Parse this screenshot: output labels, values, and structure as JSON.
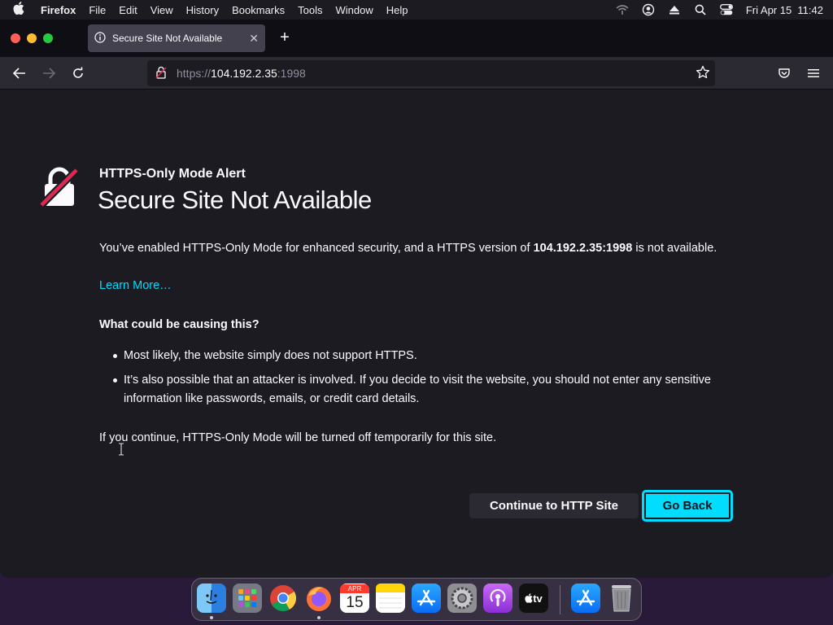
{
  "menubar": {
    "apple": "",
    "app_name": "Firefox",
    "items": [
      "File",
      "Edit",
      "View",
      "History",
      "Bookmarks",
      "Tools",
      "Window",
      "Help"
    ],
    "clock": "Fri Apr 15  11:42"
  },
  "tab": {
    "title": "Secure Site Not Available",
    "close": "✕"
  },
  "newtab": "+",
  "urlbar": {
    "scheme": "https://",
    "host": "104.192.2.35",
    "port": ":1998"
  },
  "page": {
    "kicker": "HTTPS-Only Mode Alert",
    "title": "Secure Site Not Available",
    "desc_before": "You’ve enabled HTTPS-Only Mode for enhanced security, and a HTTPS version of ",
    "desc_host": "104.192.2.35:1998",
    "desc_after": " is not available.",
    "learn_more": "Learn More…",
    "causes_title": "What could be causing this?",
    "causes": [
      "Most likely, the website simply does not support HTTPS.",
      "It’s also possible that an attacker is involved. If you decide to visit the website, you should not enter any sensitive information like passwords, emails, or credit card details."
    ],
    "continue_note": "If you continue, HTTPS-Only Mode will be turned off temporarily for this site.",
    "continue_button": "Continue to HTTP Site",
    "back_button": "Go Back"
  },
  "dock": {
    "calendar_month": "APR",
    "calendar_day": "15",
    "tv_label": "tv"
  },
  "colors": {
    "accent": "#00ddff",
    "page_bg": "#1c1b22",
    "toolbar_bg": "#2b2a33",
    "alert_red": "#e22850"
  }
}
